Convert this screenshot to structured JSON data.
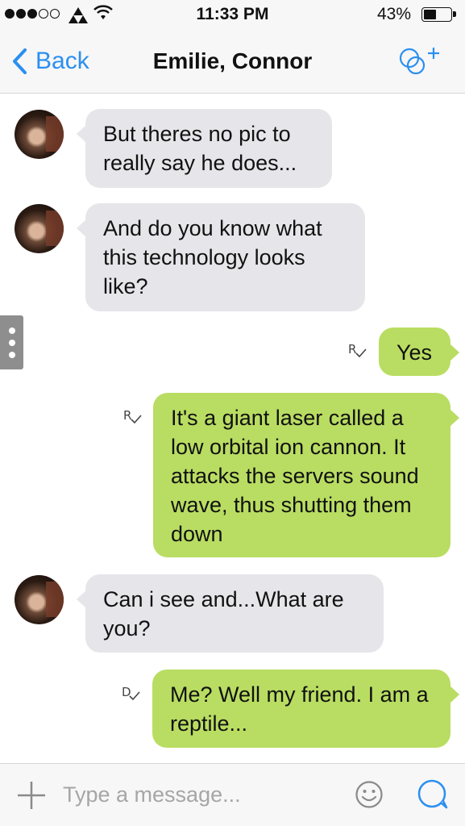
{
  "status_bar": {
    "signal_dots_filled": 3,
    "signal_dots_total": 5,
    "time": "11:33 PM",
    "battery_percent_text": "43%",
    "battery_level": 0.43
  },
  "nav": {
    "back_label": "Back",
    "title": "Emilie, Connor",
    "add_people_icon": "add-people-icon"
  },
  "messages": [
    {
      "direction": "in",
      "text": "But theres no pic to really say he does..."
    },
    {
      "direction": "in",
      "text": "And do you know what this technology looks like?"
    },
    {
      "direction": "out",
      "text": "Yes",
      "receipt": "R"
    },
    {
      "direction": "out",
      "text": "It's a giant laser called a low orbital ion cannon. It attacks the servers sound wave, thus shutting them down",
      "receipt": "R"
    },
    {
      "direction": "in",
      "text": "Can i see and...What are you?"
    },
    {
      "direction": "out",
      "text": "Me? Well my friend. I am a reptile...",
      "receipt": "D"
    }
  ],
  "input": {
    "placeholder": "Type a message..."
  },
  "colors": {
    "accent": "#2b8ff0",
    "outgoing_bubble": "#b9dd62",
    "incoming_bubble": "#e6e6ea"
  }
}
